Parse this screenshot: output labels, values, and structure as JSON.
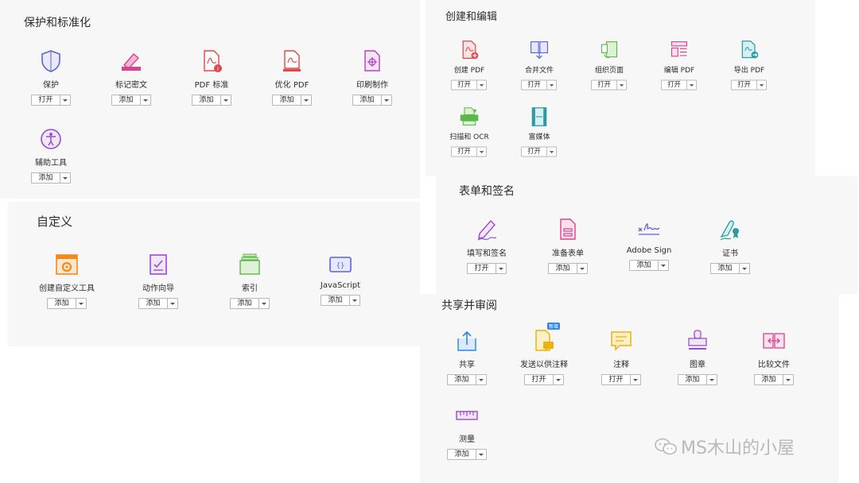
{
  "sections": {
    "protect": {
      "title": "保护和标准化",
      "tools": [
        {
          "label": "保护",
          "button": "打开",
          "icon": "shield-icon"
        },
        {
          "label": "标记密文",
          "button": "添加",
          "icon": "redact-icon"
        },
        {
          "label": "PDF 标准",
          "button": "添加",
          "icon": "pdf-standards-icon"
        },
        {
          "label": "优化 PDF",
          "button": "添加",
          "icon": "optimize-pdf-icon"
        },
        {
          "label": "印刷制作",
          "button": "添加",
          "icon": "print-production-icon"
        },
        {
          "label": "辅助工具",
          "button": "添加",
          "icon": "accessibility-icon"
        }
      ]
    },
    "custom": {
      "title": "自定义",
      "tools": [
        {
          "label": "创建自定义工具",
          "button": "添加",
          "icon": "custom-tool-icon"
        },
        {
          "label": "动作向导",
          "button": "添加",
          "icon": "action-wizard-icon"
        },
        {
          "label": "索引",
          "button": "添加",
          "icon": "index-icon"
        },
        {
          "label": "JavaScript",
          "button": "添加",
          "icon": "javascript-icon"
        }
      ]
    },
    "create": {
      "title": "创建和编辑",
      "tools": [
        {
          "label": "创建 PDF",
          "button": "打开",
          "icon": "create-pdf-icon"
        },
        {
          "label": "合并文件",
          "button": "打开",
          "icon": "combine-files-icon"
        },
        {
          "label": "组织页面",
          "button": "打开",
          "icon": "organize-pages-icon"
        },
        {
          "label": "编辑 PDF",
          "button": "打开",
          "icon": "edit-pdf-icon"
        },
        {
          "label": "导出 PDF",
          "button": "打开",
          "icon": "export-pdf-icon"
        },
        {
          "label": "扫描和 OCR",
          "button": "打开",
          "icon": "scan-ocr-icon"
        },
        {
          "label": "富媒体",
          "button": "打开",
          "icon": "rich-media-icon"
        }
      ]
    },
    "forms": {
      "title": "表单和签名",
      "tools": [
        {
          "label": "填写和签名",
          "button": "打开",
          "icon": "fill-sign-icon"
        },
        {
          "label": "准备表单",
          "button": "添加",
          "icon": "prepare-form-icon"
        },
        {
          "label": "Adobe Sign",
          "button": "添加",
          "icon": "adobe-sign-icon"
        },
        {
          "label": "证书",
          "button": "添加",
          "icon": "certificate-icon"
        }
      ]
    },
    "share": {
      "title": "共享并审阅",
      "new_badge": "新增",
      "tools": [
        {
          "label": "共享",
          "button": "添加",
          "icon": "share-icon"
        },
        {
          "label": "发送以供注释",
          "button": "打开",
          "icon": "send-for-comments-icon"
        },
        {
          "label": "注释",
          "button": "打开",
          "icon": "comment-icon"
        },
        {
          "label": "图章",
          "button": "添加",
          "icon": "stamp-icon"
        },
        {
          "label": "比较文件",
          "button": "添加",
          "icon": "compare-files-icon"
        },
        {
          "label": "测量",
          "button": "添加",
          "icon": "measure-icon"
        }
      ]
    }
  },
  "watermark": "MS木山的小屋",
  "colors": {
    "blue": "#2d86e0",
    "red": "#e0464b",
    "pink": "#d9438f",
    "purple": "#9a4ccf",
    "green": "#5bb848",
    "orange": "#f28a1b",
    "yellow": "#e9b213",
    "teal": "#2a9aa3"
  }
}
